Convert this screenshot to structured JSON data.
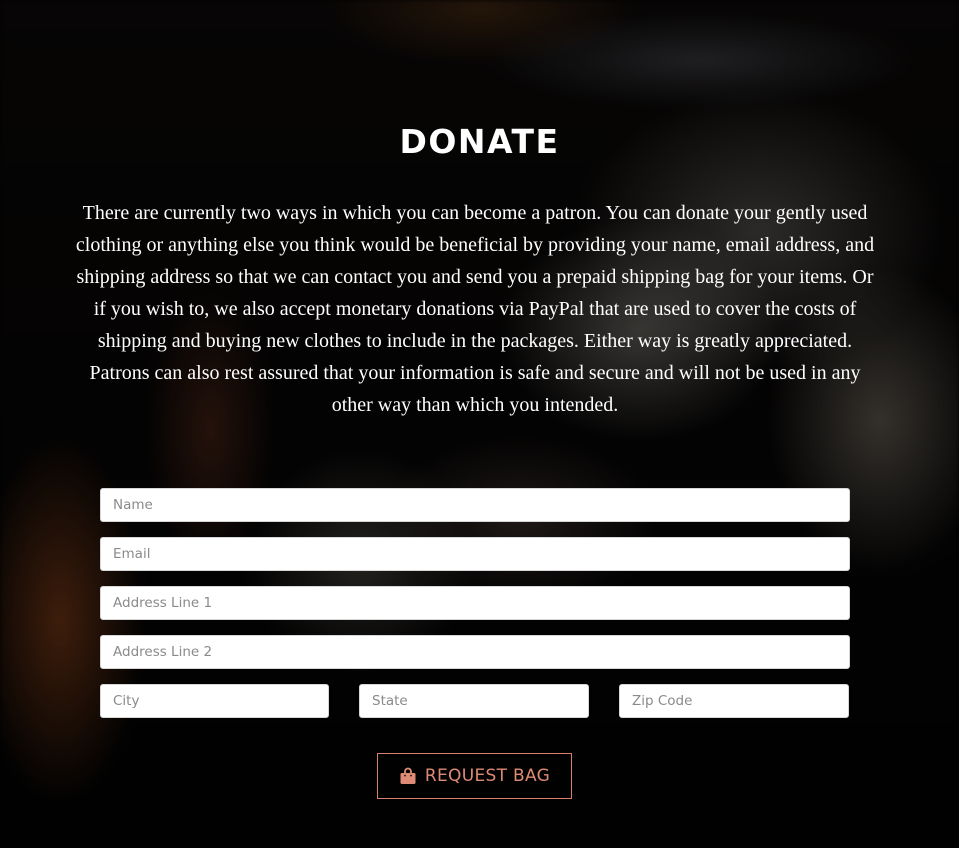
{
  "heading": "DONATE",
  "intro": "There are currently two ways in which you can become a patron. You can donate your gently used clothing or anything else you think would be beneficial by providing your name, email address, and shipping address so that we can contact you and send you a prepaid shipping bag for your items. Or if you wish to, we also accept monetary donations via PayPal that are used to cover the costs of shipping and buying new clothes to include in the packages. Either way is greatly appreciated. Patrons can also rest assured that your information is safe and secure and will not be used in any other way than which you intended.",
  "form": {
    "name_placeholder": "Name",
    "email_placeholder": "Email",
    "address1_placeholder": "Address Line 1",
    "address2_placeholder": "Address Line 2",
    "city_placeholder": "City",
    "state_placeholder": "State",
    "zip_placeholder": "Zip Code",
    "submit_label": "REQUEST BAG",
    "submit_icon": "shopping-bag-icon"
  },
  "colors": {
    "accent": "#de8a74",
    "background": "#050403",
    "text": "#ffffff",
    "input_background": "#ffffff"
  }
}
